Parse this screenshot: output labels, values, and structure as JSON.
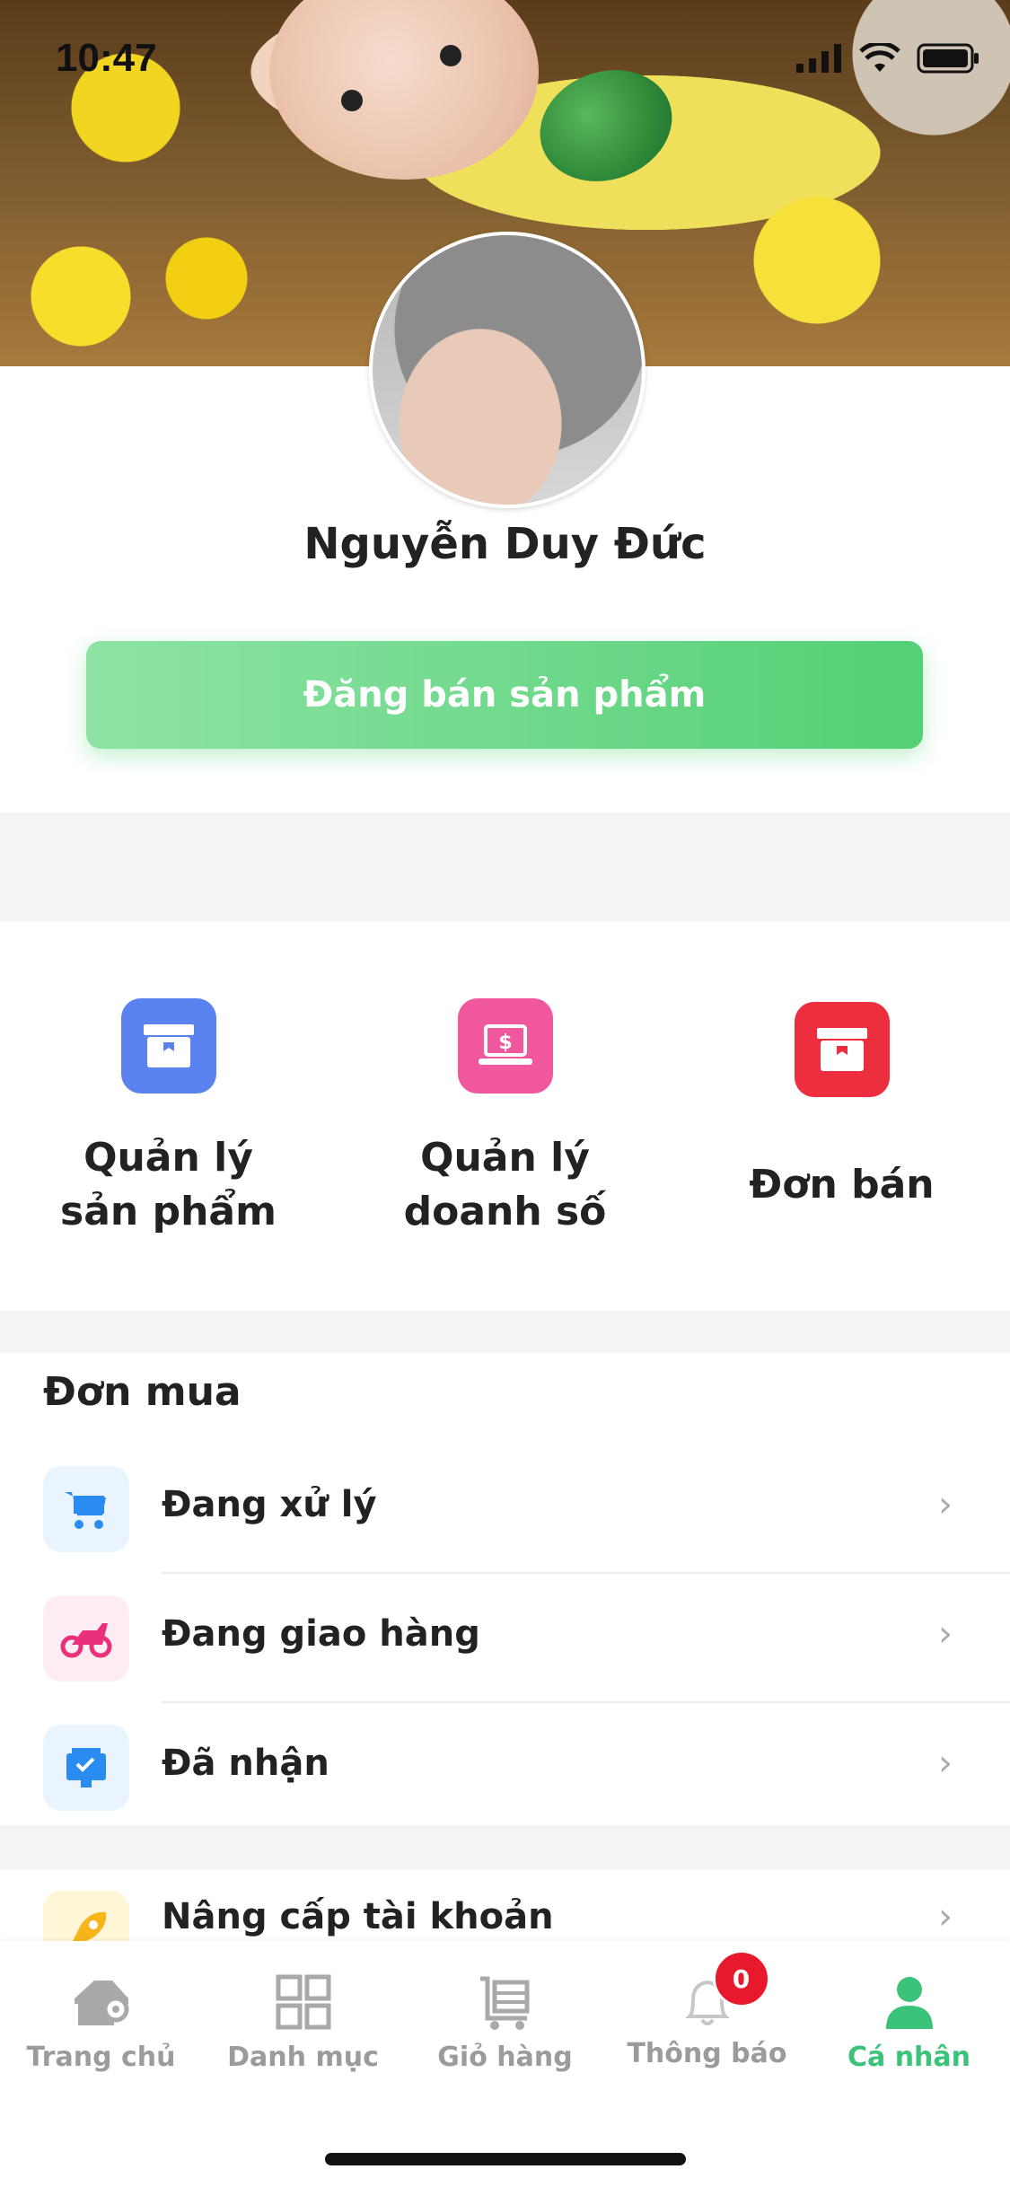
{
  "status_bar": {
    "time": "10:47"
  },
  "profile": {
    "name": "Nguyễn Duy Đức",
    "post_button_label": "Đăng bán sản phẩm"
  },
  "seller_tools": [
    {
      "label_line1": "Quản lý",
      "label_line2": "sản phẩm",
      "icon": "store-box-icon",
      "color": "#5a83f0"
    },
    {
      "label_line1": "Quản lý",
      "label_line2": "doanh số",
      "icon": "laptop-dollar-icon",
      "color": "#f0579d"
    },
    {
      "label_line1": "Đơn bán",
      "label_line2": "",
      "icon": "store-box-icon",
      "color": "#ec2e3f"
    }
  ],
  "buy_orders": {
    "title": "Đơn mua",
    "items": [
      {
        "label": "Đang xử lý",
        "icon": "cart-icon",
        "color": "#2a8cf0",
        "bg": "#e9f4fe"
      },
      {
        "label": "Đang giao hàng",
        "icon": "motorbike-icon",
        "color": "#e8317a",
        "bg": "#fdecf3"
      },
      {
        "label": "Đã nhận",
        "icon": "received-box-icon",
        "color": "#2a8cf0",
        "bg": "#e9f4fe"
      }
    ]
  },
  "upgrade": {
    "label": "Nâng cấp tài khoản",
    "icon": "rocket-icon"
  },
  "tabbar": {
    "items": [
      {
        "label": "Trang chủ",
        "icon": "home-icon"
      },
      {
        "label": "Danh mục",
        "icon": "grid-icon"
      },
      {
        "label": "Giỏ hàng",
        "icon": "cart-icon"
      },
      {
        "label": "Thông báo",
        "icon": "bell-icon",
        "badge": "0"
      },
      {
        "label": "Cá nhân",
        "icon": "person-icon"
      }
    ],
    "active_color": "#3cc37a"
  }
}
